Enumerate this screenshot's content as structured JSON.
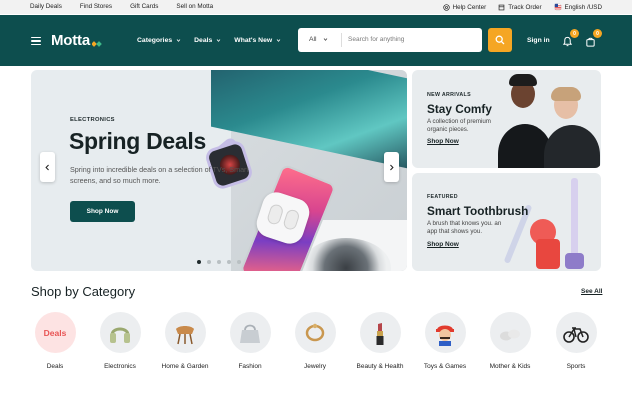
{
  "topbar": {
    "links": [
      "Daily Deals",
      "Find Stores",
      "Gift Cards",
      "Sell on Motta"
    ],
    "help": "Help Center",
    "track": "Track Order",
    "lang": "English /USD"
  },
  "header": {
    "logo": "Motta",
    "nav": [
      "Categories",
      "Deals",
      "What's New"
    ],
    "search": {
      "category": "All",
      "placeholder": "Search for anything"
    },
    "signin": "Sign in",
    "bell_count": "0",
    "bag_count": "0"
  },
  "hero": {
    "eyebrow": "ELECTRONICS",
    "title": "Spring Deals",
    "description": "Spring into incredible deals on a selection of TVs, Smart screens, and so much more.",
    "cta": "Shop Now",
    "slide_count": 5,
    "active_slide": 1
  },
  "promos": [
    {
      "eyebrow": "NEW ARRIVALS",
      "title": "Stay Comfy",
      "description": "A collection of premium organic pieces.",
      "cta": "Shop Now"
    },
    {
      "eyebrow": "FEATURED",
      "title": "Smart Toothbrush",
      "description": "A brush that knows you. an app that shows you.",
      "cta": "Shop Now"
    }
  ],
  "category_section": {
    "title": "Shop by Category",
    "see_all": "See All",
    "items": [
      {
        "label": "Deals",
        "badge": "Deals"
      },
      {
        "label": "Electronics"
      },
      {
        "label": "Home & Garden"
      },
      {
        "label": "Fashion"
      },
      {
        "label": "Jewelry"
      },
      {
        "label": "Beauty & Health"
      },
      {
        "label": "Toys & Games"
      },
      {
        "label": "Mother & Kids"
      },
      {
        "label": "Sports"
      }
    ]
  },
  "colors": {
    "brand": "#0d4e4e",
    "accent": "#f5a623",
    "deals": "#e85454"
  }
}
